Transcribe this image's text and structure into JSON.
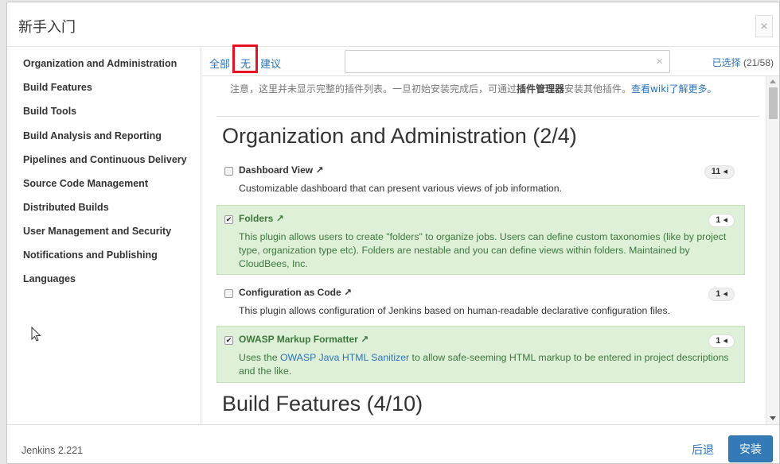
{
  "dialog": {
    "title": "新手入门",
    "close_label": "×"
  },
  "sidebar": {
    "items": [
      {
        "label": "Organization and Administration"
      },
      {
        "label": "Build Features"
      },
      {
        "label": "Build Tools"
      },
      {
        "label": "Build Analysis and Reporting"
      },
      {
        "label": "Pipelines and Continuous Delivery"
      },
      {
        "label": "Source Code Management"
      },
      {
        "label": "Distributed Builds"
      },
      {
        "label": "User Management and Security"
      },
      {
        "label": "Notifications and Publishing"
      },
      {
        "label": "Languages"
      }
    ]
  },
  "toolbar": {
    "all_label": "全部",
    "none_label": "无",
    "suggested_label": "建议",
    "search": {
      "value": "",
      "placeholder": ""
    },
    "clear_label": "×",
    "selected_label": "已选择",
    "selected_count": "(21/58)"
  },
  "notice": {
    "text_before": "注意，这里并未显示完整的插件列表。一旦初始安装完成后，可通过",
    "bold": "插件管理器",
    "text_after": "安装其他插件。",
    "link": "查看wiki了解更多。"
  },
  "sections": [
    {
      "title": "Organization and Administration (2/4)",
      "plugins": [
        {
          "name": "Dashboard View",
          "ext": "↗",
          "checked": false,
          "check_mark": "",
          "badge": "11 ◂",
          "desc": "Customizable dashboard that can present various views of job information."
        },
        {
          "name": "Folders",
          "ext": "↗",
          "checked": true,
          "check_mark": "✔",
          "badge": "1 ◂",
          "desc": "This plugin allows users to create \"folders\" to organize jobs. Users can define custom taxonomies (like by project type, organization type etc). Folders are nestable and you can define views within folders. Maintained by CloudBees, Inc."
        },
        {
          "name": "Configuration as Code",
          "ext": "↗",
          "checked": false,
          "check_mark": "",
          "badge": "1 ◂",
          "desc": "This plugin allows configuration of Jenkins based on human-readable declarative configuration files."
        },
        {
          "name": "OWASP Markup Formatter",
          "ext": "↗",
          "checked": true,
          "check_mark": "✔",
          "badge": "1 ◂",
          "desc_before": "Uses the ",
          "desc_link": "OWASP Java HTML Sanitizer",
          "desc_after": " to allow safe-seeming HTML markup to be entered in project descriptions and the like."
        }
      ]
    },
    {
      "title": "Build Features (4/10)"
    }
  ],
  "footer": {
    "version": "Jenkins 2.221",
    "back_label": "后退",
    "install_label": "安装"
  },
  "colors": {
    "accent": "#337ab7",
    "link": "#2c73b8",
    "selected_bg": "#dff0d8",
    "highlight": "#e81123"
  }
}
